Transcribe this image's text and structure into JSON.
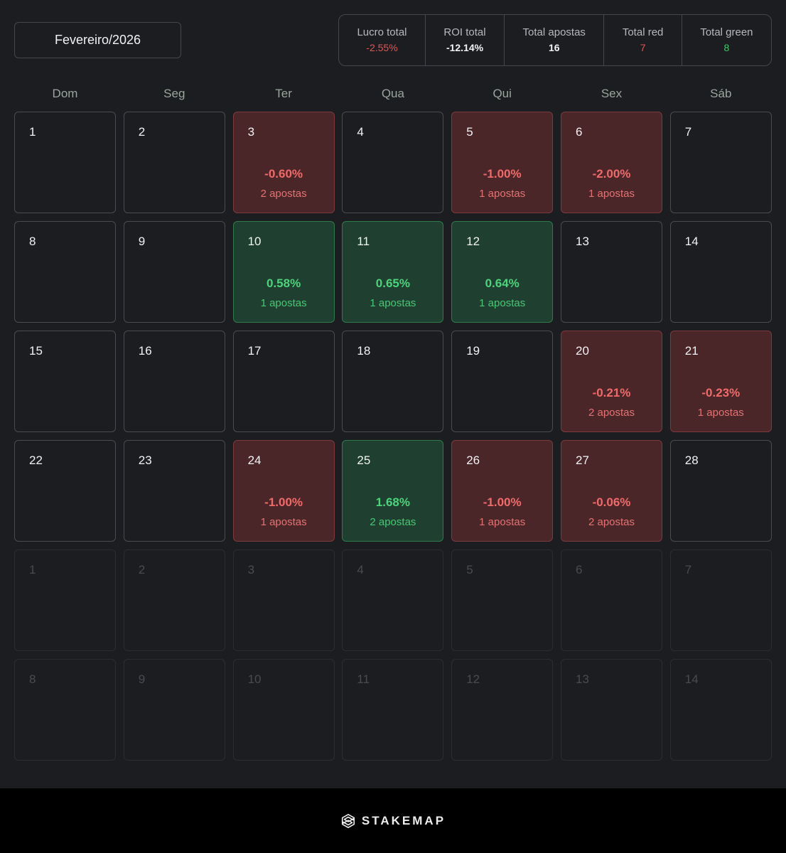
{
  "month_selector": {
    "label": "Fevereiro/2026"
  },
  "stats": [
    {
      "label": "Lucro total",
      "value": "-2.55%",
      "tone": "red"
    },
    {
      "label": "ROI total",
      "value": "-12.14%",
      "tone": "white"
    },
    {
      "label": "Total apostas",
      "value": "16",
      "tone": "white"
    },
    {
      "label": "Total red",
      "value": "7",
      "tone": "red"
    },
    {
      "label": "Total green",
      "value": "8",
      "tone": "green"
    }
  ],
  "weekdays": [
    "Dom",
    "Seg",
    "Ter",
    "Qua",
    "Qui",
    "Sex",
    "Sáb"
  ],
  "days": [
    {
      "day": "1"
    },
    {
      "day": "2"
    },
    {
      "day": "3",
      "pct": "-0.60%",
      "count": "2 apostas",
      "status": "red"
    },
    {
      "day": "4"
    },
    {
      "day": "5",
      "pct": "-1.00%",
      "count": "1 apostas",
      "status": "red"
    },
    {
      "day": "6",
      "pct": "-2.00%",
      "count": "1 apostas",
      "status": "red"
    },
    {
      "day": "7"
    },
    {
      "day": "8"
    },
    {
      "day": "9"
    },
    {
      "day": "10",
      "pct": "0.58%",
      "count": "1 apostas",
      "status": "green"
    },
    {
      "day": "11",
      "pct": "0.65%",
      "count": "1 apostas",
      "status": "green"
    },
    {
      "day": "12",
      "pct": "0.64%",
      "count": "1 apostas",
      "status": "green"
    },
    {
      "day": "13"
    },
    {
      "day": "14"
    },
    {
      "day": "15"
    },
    {
      "day": "16"
    },
    {
      "day": "17"
    },
    {
      "day": "18"
    },
    {
      "day": "19"
    },
    {
      "day": "20",
      "pct": "-0.21%",
      "count": "2 apostas",
      "status": "red"
    },
    {
      "day": "21",
      "pct": "-0.23%",
      "count": "1 apostas",
      "status": "red"
    },
    {
      "day": "22"
    },
    {
      "day": "23"
    },
    {
      "day": "24",
      "pct": "-1.00%",
      "count": "1 apostas",
      "status": "red"
    },
    {
      "day": "25",
      "pct": "1.68%",
      "count": "2 apostas",
      "status": "green"
    },
    {
      "day": "26",
      "pct": "-1.00%",
      "count": "1 apostas",
      "status": "red"
    },
    {
      "day": "27",
      "pct": "-0.06%",
      "count": "2 apostas",
      "status": "red"
    },
    {
      "day": "28"
    },
    {
      "day": "1",
      "status": "out"
    },
    {
      "day": "2",
      "status": "out"
    },
    {
      "day": "3",
      "status": "out"
    },
    {
      "day": "4",
      "status": "out"
    },
    {
      "day": "5",
      "status": "out"
    },
    {
      "day": "6",
      "status": "out"
    },
    {
      "day": "7",
      "status": "out"
    },
    {
      "day": "8",
      "status": "out"
    },
    {
      "day": "9",
      "status": "out"
    },
    {
      "day": "10",
      "status": "out"
    },
    {
      "day": "11",
      "status": "out"
    },
    {
      "day": "12",
      "status": "out"
    },
    {
      "day": "13",
      "status": "out"
    },
    {
      "day": "14",
      "status": "out"
    }
  ],
  "footer": {
    "brand": "STAKEMAP",
    "icon": "stakemap-logo-icon"
  }
}
